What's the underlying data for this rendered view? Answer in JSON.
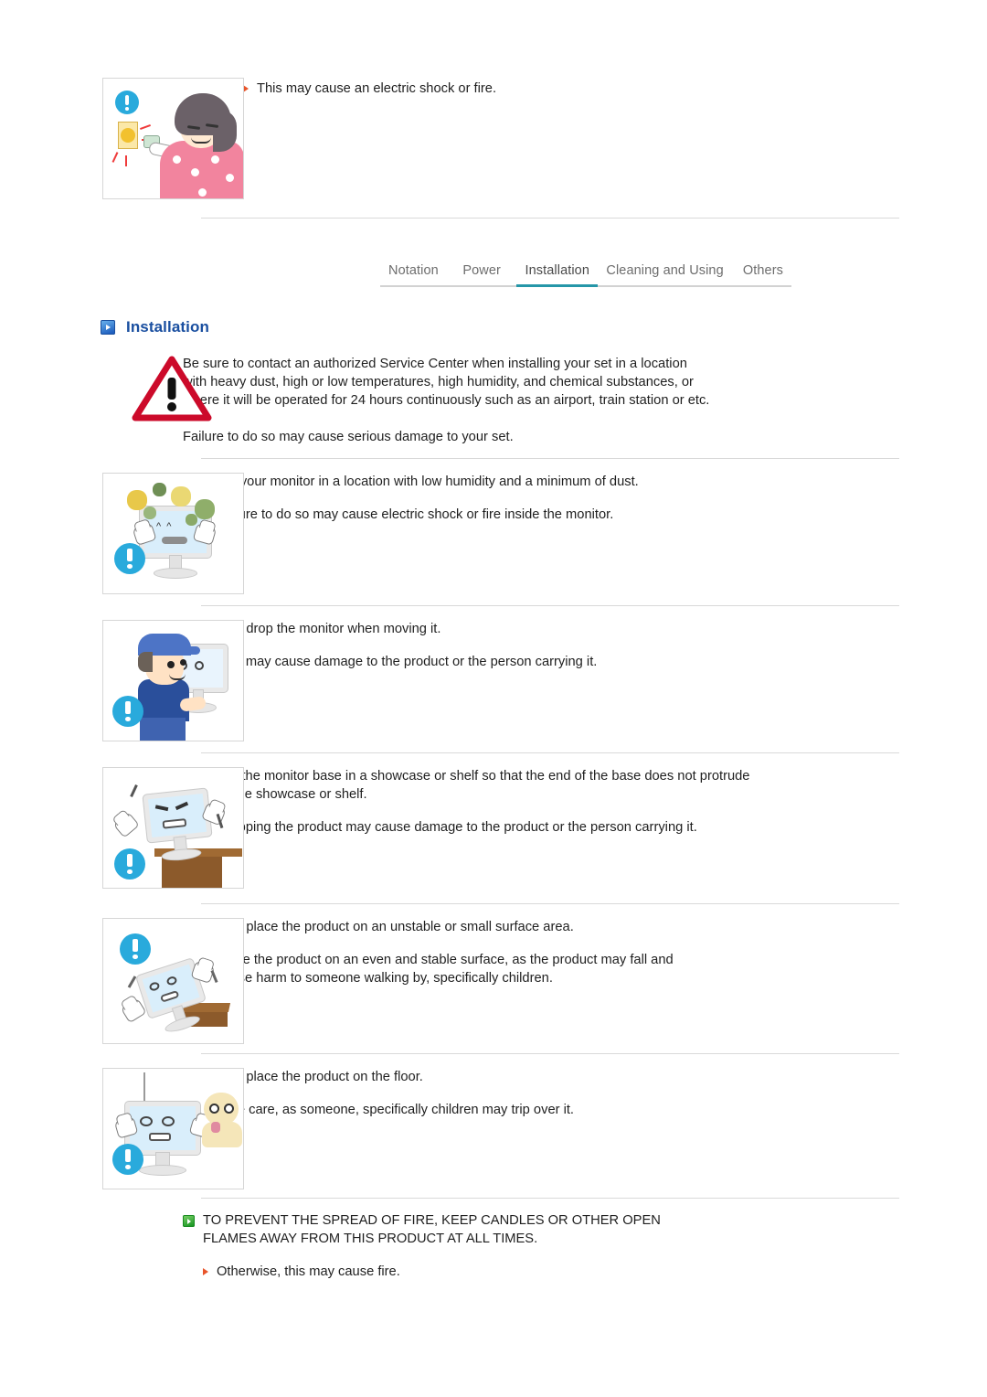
{
  "document": {
    "title": "Installation",
    "top_note": {
      "sub_bullet": "This may cause an electric shock or fire."
    },
    "tabs": [
      {
        "label": "Notation",
        "active": false
      },
      {
        "label": "Power",
        "active": false
      },
      {
        "label": "Installation",
        "active": true
      },
      {
        "label": "Cleaning and Using",
        "active": false
      },
      {
        "label": "Others",
        "active": false
      }
    ],
    "warning": {
      "paragraph": "Be sure to contact an authorized Service Center when installing your set in a location with heavy dust, high or low temperatures, high humidity, and chemical substances, or where it will be operated for 24 hours continuously such as an airport, train station or etc.",
      "note": "Failure to do so may cause serious damage to your set."
    },
    "items": [
      {
        "main": "Place your monitor in a location with low humidity and a minimum of dust.",
        "subs": [
          "Failure to do so may cause electric shock or fire inside the monitor."
        ],
        "illustration": "monitor-with-dust"
      },
      {
        "main": "Do not drop the monitor when moving it.",
        "subs": [
          "This may cause damage to the product or the person carrying it."
        ],
        "illustration": "man-carrying-monitor"
      },
      {
        "main": "Install the monitor base in a showcase or shelf so that the end of the base does not protrude from the showcase or shelf.",
        "subs": [
          "Dropping the product may cause damage to the product or the person carrying it."
        ],
        "illustration": "monitor-on-shelf-edge"
      },
      {
        "main": "Do not place the product on an unstable or small surface area.",
        "subs": [
          "Place the product on an even and stable surface, as the product may fall and cause harm to someone walking by, specifically children."
        ],
        "illustration": "monitor-falling-off-stool"
      },
      {
        "main": "Do not place the product on the floor.",
        "subs": [
          "Take care, as someone, specifically children may trip over it."
        ],
        "illustration": "monitor-on-floor-with-child"
      },
      {
        "main": "TO PREVENT THE SPREAD OF FIRE, KEEP CANDLES OR OTHER OPEN FLAMES AWAY FROM THIS PRODUCT AT ALL TIMES.",
        "subs": [
          "Otherwise, this may cause fire."
        ],
        "illustration": "none"
      }
    ],
    "icons": {
      "section_marker": "blue-play-chip-icon",
      "main_bullet": "green-play-chip-icon",
      "sub_bullet": "orange-triangle-bullet-icon",
      "caution": "red-warning-triangle-icon",
      "mandatory": "blue-exclamation-circle-icon"
    },
    "colors": {
      "heading_blue": "#1a4fa0",
      "tab_active_underline": "#2596a8",
      "bullet_green": "#1f9a27",
      "sub_bullet_orange": "#e8542a",
      "caution_red": "#cc0a2a",
      "mandatory_blue": "#29aadc",
      "rule_gray": "#d9d9d9"
    }
  }
}
